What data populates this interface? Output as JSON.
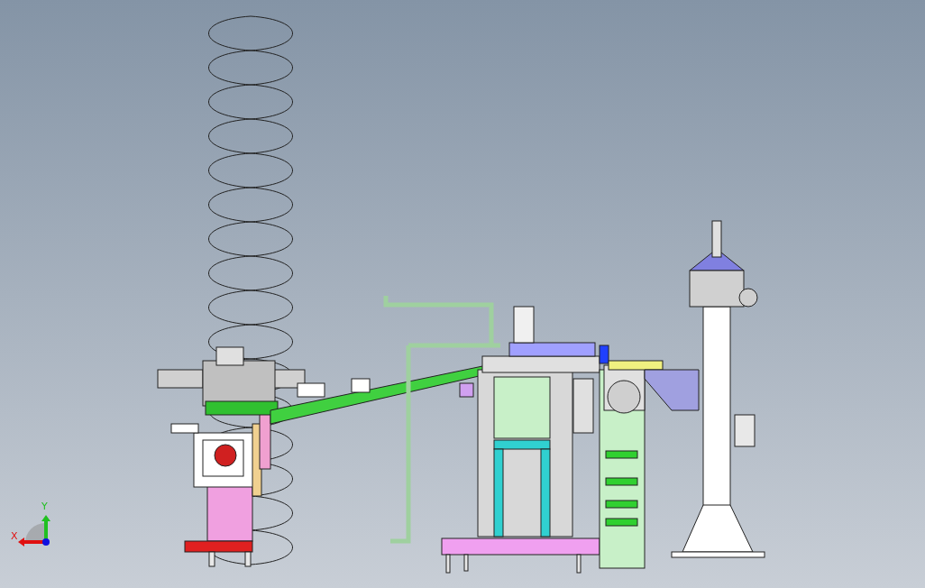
{
  "viewport": {
    "axis_labels": [
      {
        "kind": "x",
        "label": "X"
      },
      {
        "kind": "y",
        "label": "Y"
      }
    ]
  }
}
